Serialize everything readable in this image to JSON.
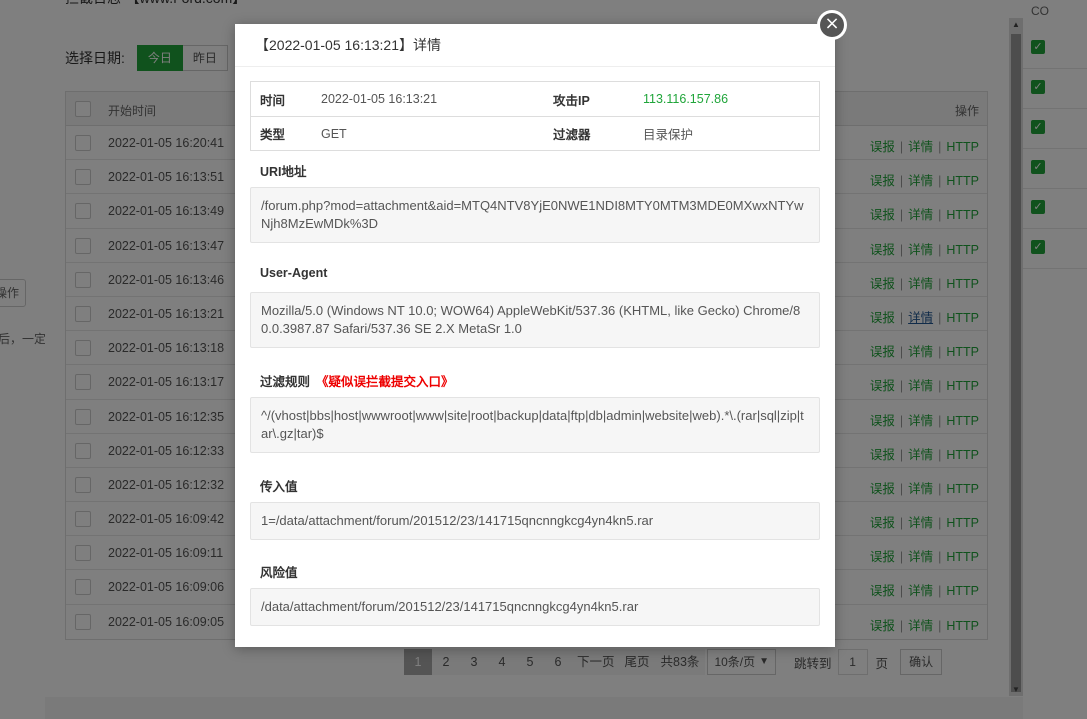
{
  "base": {
    "right_header": "CO",
    "left_button": "操作",
    "left_text": "后，一定"
  },
  "log": {
    "title": "拦截日志-【www.f-ord.com】",
    "date_label": "选择日期:",
    "date_buttons": [
      "今日",
      "昨日"
    ],
    "table_header": {
      "start_time": "开始时间",
      "ops": "操作"
    },
    "rows": [
      {
        "time": "2022-01-05 16:20:41"
      },
      {
        "time": "2022-01-05 16:13:51"
      },
      {
        "time": "2022-01-05 16:13:49"
      },
      {
        "time": "2022-01-05 16:13:47"
      },
      {
        "time": "2022-01-05 16:13:46"
      },
      {
        "time": "2022-01-05 16:13:21"
      },
      {
        "time": "2022-01-05 16:13:18"
      },
      {
        "time": "2022-01-05 16:13:17"
      },
      {
        "time": "2022-01-05 16:12:35"
      },
      {
        "time": "2022-01-05 16:12:33"
      },
      {
        "time": "2022-01-05 16:12:32"
      },
      {
        "time": "2022-01-05 16:09:42"
      },
      {
        "time": "2022-01-05 16:09:11"
      },
      {
        "time": "2022-01-05 16:09:06"
      },
      {
        "time": "2022-01-05 16:09:05"
      }
    ],
    "ops": {
      "report": "误报",
      "detail": "详情",
      "http": "HTTP",
      "sep": "|"
    },
    "pager": {
      "pages": [
        "1",
        "2",
        "3",
        "4",
        "5",
        "6"
      ],
      "next": "下一页",
      "last": "尾页",
      "total": "共83条",
      "per_page": "10条/页",
      "jump_label": "跳转到",
      "jump_value": "1",
      "unit": "页",
      "confirm": "确认"
    }
  },
  "dialog": {
    "title": "【2022-01-05 16:13:21】详情",
    "close_glyph": "×",
    "time_label": "时间",
    "time_value": "2022-01-05 16:13:21",
    "ip_label": "攻击IP",
    "ip_value": "113.116.157.86",
    "type_label": "类型",
    "type_value": "GET",
    "filter_label": "过滤器",
    "filter_value": "目录保护",
    "uri_label": "URI地址",
    "uri_value": "/forum.php?mod=attachment&aid=MTQ4NTV8YjE0NWE1NDI8MTY0MTM3MDE0MXwxNTYwNjh8MzEwMDk%3D",
    "ua_label": "User-Agent",
    "ua_value": "Mozilla/5.0 (Windows NT 10.0; WOW64) AppleWebKit/537.36 (KHTML, like Gecko) Chrome/80.0.3987.87 Safari/537.36 SE 2.X MetaSr 1.0",
    "rule_label": "过滤规则",
    "rule_link": "《疑似误拦截提交入口》",
    "rule_value": "^/(vhost|bbs|host|wwwroot|www|site|root|backup|data|ftp|db|admin|website|web).*\\.(rar|sql|zip|tar\\.gz|tar)$",
    "input_label": "传入值",
    "input_value": "1=/data/attachment/forum/201512/23/141715qncnngkcg4yn4kn5.rar",
    "risk_label": "风险值",
    "risk_value": "/data/attachment/forum/201512/23/141715qncnngkcg4yn4kn5.rar"
  },
  "colors": {
    "accent": "#20a53a",
    "link_red": "#e00000",
    "overlay": "rgba(0,0,0,0.5)"
  }
}
